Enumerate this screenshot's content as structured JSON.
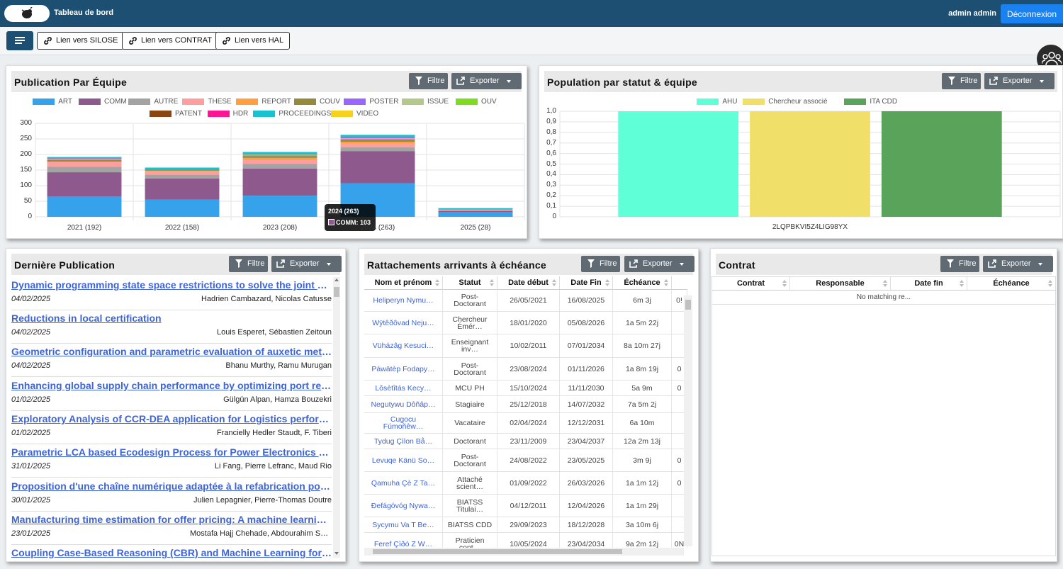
{
  "header": {
    "title": "Tableau de bord",
    "user": "admin admin",
    "logout": "Déconnexion"
  },
  "toolbar": {
    "links": [
      "Lien vers SILOSE",
      "Lien vers CONTRAT",
      "Lien vers HAL"
    ]
  },
  "common": {
    "filter": "Filtre",
    "export": "Exporter"
  },
  "pub_team": {
    "title": "Publication Par Équipe",
    "tooltip_title": "2024 (263)",
    "tooltip_value": "COMM: 103"
  },
  "population": {
    "title": "Population par statut & équipe"
  },
  "last_pub": {
    "title": "Dernière Publication",
    "items": [
      {
        "title": "Dynamic programming state space restrictions to solve the joint order batching",
        "date": "04/02/2025",
        "authors": "Hadrien Cambazard, Nicolas Catusse"
      },
      {
        "title": "Reductions in local certification",
        "date": "04/02/2025",
        "authors": "Louis Esperet, Sébastien Zeitoun"
      },
      {
        "title": "Geometric configuration and parametric evaluation of auxetic meta-materials",
        "date": "04/02/2025",
        "authors": "Bhanu Murthy, Ramu Murugan"
      },
      {
        "title": "Enhancing global supply chain performance by optimizing port resources",
        "date": "01/02/2025",
        "authors": "Gülgün Alpan, Hamza Bouzekri"
      },
      {
        "title": "Exploratory Analysis of CCR-DEA application for Logistics performance",
        "date": "01/02/2025",
        "authors": "Francielly Hedler Staudt, F. Tiberi"
      },
      {
        "title": "Parametric LCA based Ecodesign Process for Power Electronics Products",
        "date": "31/01/2025",
        "authors": "Li Fang, Pierre Lefranc, Maud Rio"
      },
      {
        "title": "Proposition d'une chaîne numérique adaptée à la refabrication pour la",
        "date": "30/01/2025",
        "authors": "Julien Lepagnier, Pierre-Thomas Doutre"
      },
      {
        "title": "Manufacturing time estimation for offer pricing: A machine learning approach",
        "date": "23/01/2025",
        "authors": "Mostafa Hajj Chehade, Abdourahim Sylla"
      },
      {
        "title": "Coupling Case-Based Reasoning (CBR) and Machine Learning for Manufacturing",
        "date": "",
        "authors": ""
      }
    ]
  },
  "rattach": {
    "title": "Rattachements arrivants à échéance",
    "headers": [
      "Nom et prénom",
      "Statut",
      "Date début",
      "Date Fin",
      "Échéance"
    ],
    "rows": [
      [
        "Heliperyn Nymu…",
        "Post-\nDoctorant",
        "26/05/2021",
        "16/08/2025",
        "6m 3j",
        "0!"
      ],
      [
        "Wÿtêðôvad Neju…",
        "Chercheur\nÉmér…",
        "18/01/2020",
        "05/08/2026",
        "1a 5m 22j",
        ""
      ],
      [
        "Vüházâg Kesuci…",
        "Enseignant\ninv…",
        "10/02/2011",
        "07/01/2034",
        "8a 10m 27j",
        ""
      ],
      [
        "Páwätèp Fodapy…",
        "Post-\nDoctorant",
        "23/08/2024",
        "01/11/2026",
        "1a 8m 19j",
        "0"
      ],
      [
        "Lôsètîtás Kecy…",
        "MCU PH",
        "15/10/2024",
        "11/11/2030",
        "5a 9m",
        "0"
      ],
      [
        "Negutywu Dôñâp…",
        "Stagiaire",
        "25/12/2018",
        "14/07/2032",
        "7a 5m 2j",
        ""
      ],
      [
        "Cugocu\nFúmoñêw…",
        "Vacataire",
        "02/04/2024",
        "12/12/2031",
        "6a 10m",
        ""
      ],
      [
        "Tydug Çìlon Bå…",
        "Doctorant",
        "23/11/2009",
        "23/04/2037",
        "12a 2m 13j",
        ""
      ],
      [
        "Levuqe Känü So…",
        "Post-\nDoctorant",
        "24/08/2022",
        "23/05/2025",
        "3m 9j",
        "0"
      ],
      [
        "Qamuha Çè Z Ta…",
        "Attaché\nscient…",
        "01/09/2022",
        "26/03/2026",
        "1a 1m 12j",
        "0"
      ],
      [
        "Ðefágóvóg Nywa…",
        "BIATSS\nTitulai…",
        "04/12/2011",
        "12/04/2026",
        "1a 1m 29j",
        ""
      ],
      [
        "Sycymu Va T Be…",
        "BIATSS CDD",
        "29/09/2023",
        "18/12/2028",
        "3a 10m 6j",
        ""
      ],
      [
        "Feref Çìðó Z W…",
        "Praticien\ncont…",
        "10/05/2024",
        "23/04/2034",
        "9a 2m 12j",
        "0N"
      ]
    ]
  },
  "contrat": {
    "title": "Contrat",
    "headers": [
      "Contrat",
      "Responsable",
      "Date fin",
      "Échéance"
    ],
    "empty": "No matching re..."
  },
  "chart_data": [
    {
      "type": "bar",
      "stacked": true,
      "categories": [
        "2021 (192)",
        "2022 (158)",
        "2023 (208)",
        "2024 (263)",
        "2025 (28)"
      ],
      "ylim": [
        0,
        300
      ],
      "yticks": [
        0,
        50,
        100,
        150,
        200,
        250,
        300
      ],
      "legend_position": "top",
      "grid": true,
      "series": [
        {
          "name": "ART",
          "color": "#36a2eb",
          "values": [
            65,
            55,
            68,
            108,
            15
          ]
        },
        {
          "name": "COMM",
          "color": "#8e5a8e",
          "values": [
            78,
            68,
            87,
            103,
            4
          ]
        },
        {
          "name": "AUTRE",
          "color": "#a3a3a3",
          "values": [
            18,
            12,
            15,
            12,
            2
          ]
        },
        {
          "name": "THESE",
          "color": "#ff9e9e",
          "values": [
            16,
            10,
            13,
            12,
            2
          ]
        },
        {
          "name": "REPORT",
          "color": "#ff9f40",
          "values": [
            0,
            3,
            6,
            6,
            0
          ]
        },
        {
          "name": "COUV",
          "color": "#958a3b",
          "values": [
            5,
            3,
            6,
            5,
            1
          ]
        },
        {
          "name": "POSTER",
          "color": "#9966ff",
          "values": [
            0,
            0,
            2,
            3,
            0
          ]
        },
        {
          "name": "ISSUE",
          "color": "#b3c88a",
          "values": [
            3,
            0,
            3,
            3,
            0
          ]
        },
        {
          "name": "OUV",
          "color": "#7ddc1f",
          "values": [
            0,
            0,
            0,
            0,
            0
          ]
        },
        {
          "name": "PATENT",
          "color": "#8b4513",
          "values": [
            0,
            0,
            0,
            0,
            0
          ]
        },
        {
          "name": "HDR",
          "color": "#ff1493",
          "values": [
            2,
            1,
            1,
            2,
            0
          ]
        },
        {
          "name": "PROCEEDINGS",
          "color": "#17c3d0",
          "values": [
            5,
            6,
            7,
            9,
            4
          ]
        },
        {
          "name": "VIDEO",
          "color": "#f6d21c",
          "values": [
            0,
            0,
            0,
            0,
            0
          ]
        }
      ]
    },
    {
      "type": "bar",
      "categories": [
        "2LQPBKVI5Z4LIG98YX"
      ],
      "ylim": [
        0,
        1
      ],
      "yticks": [
        "0",
        "0,1",
        "0,2",
        "0,3",
        "0,4",
        "0,5",
        "0,6",
        "0,7",
        "0,8",
        "0,9",
        "1,0"
      ],
      "legend_position": "top",
      "series": [
        {
          "name": "AHU",
          "color": "#5fffd8",
          "values": [
            1
          ]
        },
        {
          "name": "Chercheur associé",
          "color": "#f0e06a",
          "values": [
            1
          ]
        },
        {
          "name": "ITA CDD",
          "color": "#5aa35a",
          "values": [
            1
          ]
        }
      ]
    }
  ]
}
